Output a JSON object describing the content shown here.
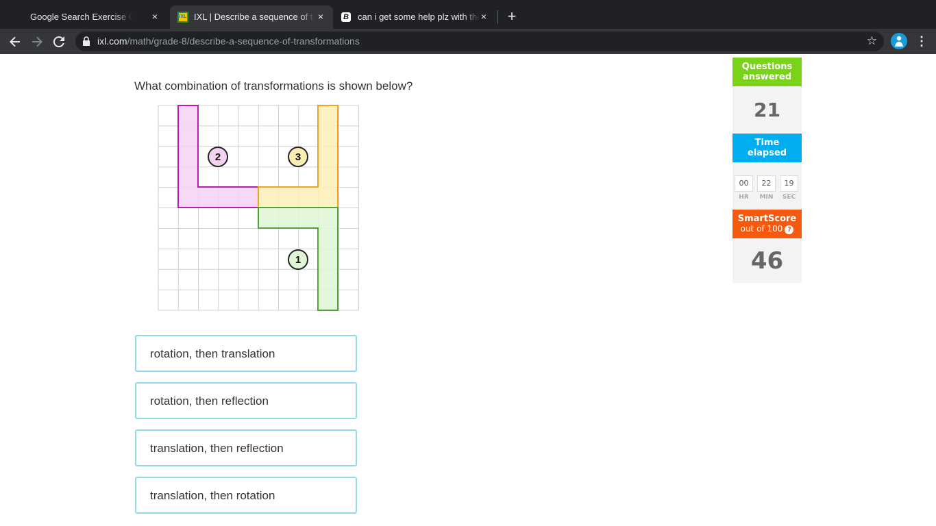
{
  "browser": {
    "tabs": [
      {
        "title": "Google Search Exercise Career",
        "close": "×"
      },
      {
        "title": "IXL | Describe a sequence of tr",
        "close": "×",
        "favicon": "IXL"
      },
      {
        "title": "can i get some help plz with thi",
        "close": "×",
        "favicon": "B"
      }
    ],
    "new_tab": "+",
    "url_host": "ixl.com",
    "url_path": "/math/grade-8/describe-a-sequence-of-transformations",
    "icons": [
      "back-arrow-icon",
      "forward-arrow-icon",
      "reload-icon",
      "lock-icon",
      "star-icon",
      "profile-icon",
      "menu-dots-icon"
    ]
  },
  "question": {
    "text": "What combination of transformations is shown below?",
    "figure": {
      "grid_columns": 10,
      "grid_rows": 10,
      "shapes": [
        {
          "label": "1",
          "fill": "#dff5d6",
          "stroke": "#4ca832"
        },
        {
          "label": "2",
          "fill": "#f5d2f2",
          "stroke": "#b81cb5"
        },
        {
          "label": "3",
          "fill": "#fbeeb5",
          "stroke": "#f2a421"
        }
      ]
    }
  },
  "choices": [
    "rotation, then translation",
    "rotation, then reflection",
    "translation, then reflection",
    "translation, then rotation"
  ],
  "sidebar": {
    "questions_label_1": "Questions",
    "questions_label_2": "answered",
    "questions_value": "21",
    "time_label_1": "Time",
    "time_label_2": "elapsed",
    "time": {
      "hr": "00",
      "min": "22",
      "sec": "19"
    },
    "time_units": {
      "hr": "HR",
      "min": "MIN",
      "sec": "SEC"
    },
    "smartscore_label": "SmartScore",
    "smartscore_sub": "out of 100",
    "smartscore_help": "?",
    "smartscore_value": "46",
    "colors": {
      "questions": "#7ad219",
      "time": "#00aeef",
      "smartscore": "#f65a0f"
    }
  }
}
